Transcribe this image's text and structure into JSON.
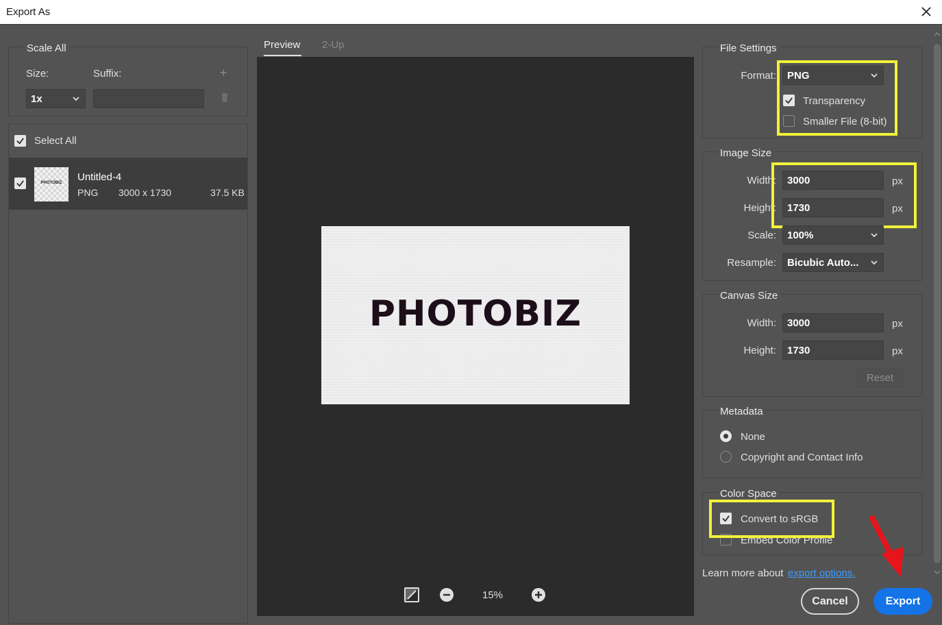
{
  "window": {
    "title": "Export As"
  },
  "scale": {
    "group_title": "Scale All",
    "size_label": "Size:",
    "suffix_label": "Suffix:",
    "size_value": "1x",
    "suffix_value": ""
  },
  "assets": {
    "select_all_label": "Select All",
    "items": [
      {
        "name": "Untitled-4",
        "format": "PNG",
        "dimensions": "3000 x 1730",
        "filesize": "37.5 KB",
        "thumb_text": "PHOTOBIZ"
      }
    ]
  },
  "preview": {
    "tabs": [
      "Preview",
      "2-Up"
    ],
    "active_tab": "Preview",
    "image_text": "PHOTOBIZ",
    "zoom": "15%"
  },
  "file_settings": {
    "group_title": "File Settings",
    "format_label": "Format:",
    "format_value": "PNG",
    "transparency_label": "Transparency",
    "transparency_checked": true,
    "smaller_file_label": "Smaller File (8-bit)",
    "smaller_file_checked": false
  },
  "image_size": {
    "group_title": "Image Size",
    "width_label": "Width:",
    "width_value": "3000",
    "height_label": "Height:",
    "height_value": "1730",
    "unit": "px",
    "scale_label": "Scale:",
    "scale_value": "100%",
    "resample_label": "Resample:",
    "resample_value": "Bicubic Auto..."
  },
  "canvas_size": {
    "group_title": "Canvas Size",
    "width_label": "Width:",
    "width_value": "3000",
    "height_label": "Height:",
    "height_value": "1730",
    "unit": "px",
    "reset_label": "Reset"
  },
  "metadata": {
    "group_title": "Metadata",
    "options": [
      "None",
      "Copyright and Contact Info"
    ],
    "selected": "None"
  },
  "color_space": {
    "group_title": "Color Space",
    "convert_label": "Convert to sRGB",
    "convert_checked": true,
    "embed_label": "Embed Color Profile",
    "embed_checked": false
  },
  "footer": {
    "learn_more_text": "Learn more about",
    "link_text": "export options.",
    "cancel_label": "Cancel",
    "export_label": "Export"
  },
  "colors": {
    "accent": "#1473e6",
    "highlight": "#f2f23a",
    "arrow": "#e8141c"
  }
}
